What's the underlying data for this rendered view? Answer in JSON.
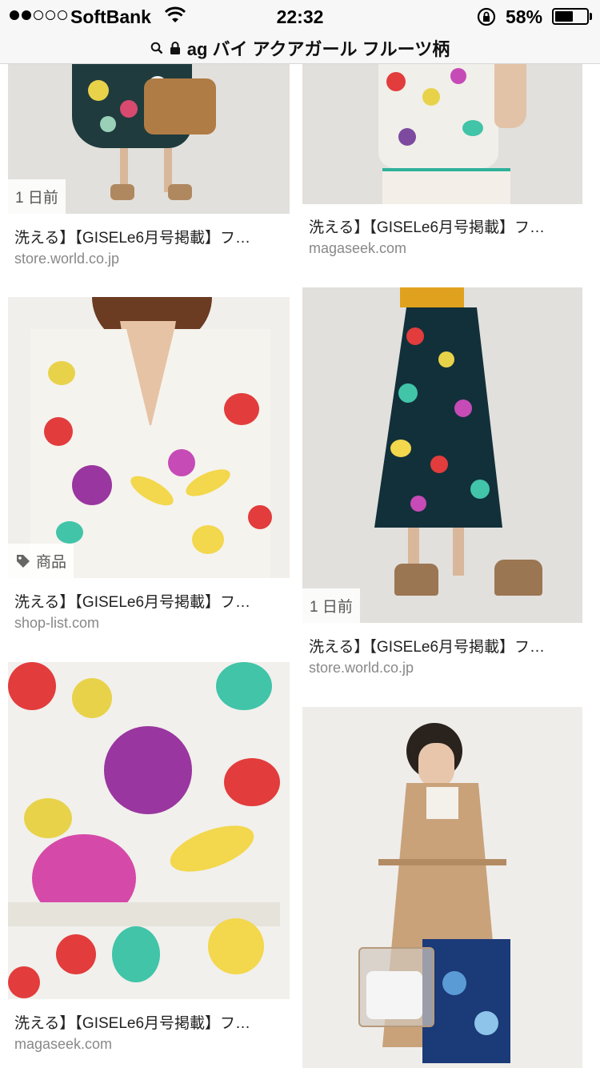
{
  "status_bar": {
    "carrier": "SoftBank",
    "time": "22:32",
    "battery_percent": "58%",
    "battery_level": 0.58
  },
  "url_bar": {
    "query": "ag バイ アクアガール フルーツ柄"
  },
  "results": [
    {
      "title": "洗える】【GISELe6月号掲載】フ…",
      "source": "store.world.co.jp",
      "badge": "1 日前"
    },
    {
      "title": "洗える】【GISELe6月号掲載】フ…",
      "source": "magaseek.com",
      "badge": ""
    },
    {
      "title": "洗える】【GISELe6月号掲載】フ…",
      "source": "shop-list.com",
      "badge": "商品"
    },
    {
      "title": "洗える】【GISELe6月号掲載】フ…",
      "source": "store.world.co.jp",
      "badge": "1 日前"
    },
    {
      "title": "洗える】【GISELe6月号掲載】フ…",
      "source": "magaseek.com",
      "badge": ""
    },
    {
      "title": "",
      "source": "",
      "badge": ""
    }
  ],
  "colors": {
    "source_text": "#888888",
    "title_text": "#222222",
    "topbar_bg": "#f7f7f7"
  }
}
